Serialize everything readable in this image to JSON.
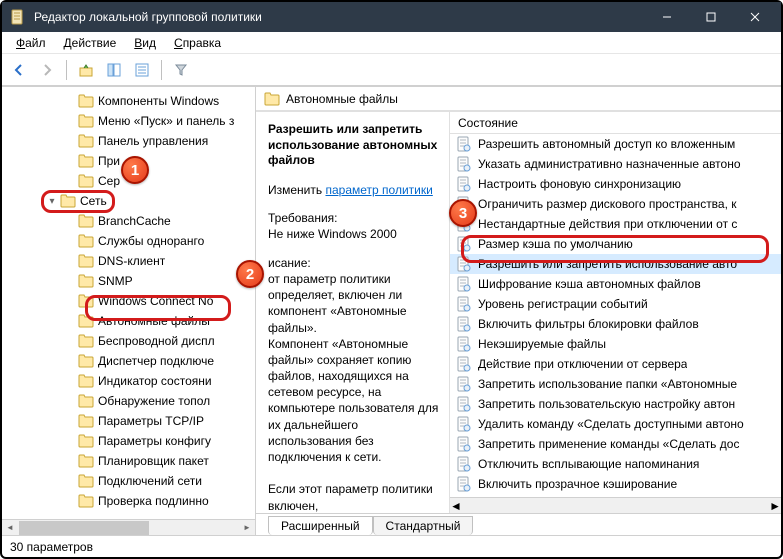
{
  "window": {
    "title": "Редактор локальной групповой политики"
  },
  "menubar": [
    "Файл",
    "Действие",
    "Вид",
    "Справка"
  ],
  "tree": [
    {
      "indent": 3,
      "exp": "",
      "label": "Компоненты Windows"
    },
    {
      "indent": 3,
      "exp": "",
      "label": "Меню «Пуск» и панель з"
    },
    {
      "indent": 3,
      "exp": "",
      "label": "Панель управления"
    },
    {
      "indent": 3,
      "exp": "",
      "label": "При"
    },
    {
      "indent": 3,
      "exp": "",
      "label": "Сер"
    },
    {
      "indent": 2,
      "exp": "▾",
      "label": "Сеть"
    },
    {
      "indent": 3,
      "exp": "",
      "label": "BranchCache"
    },
    {
      "indent": 3,
      "exp": "",
      "label": "Службы одноранго"
    },
    {
      "indent": 3,
      "exp": "",
      "label": "DNS-клиент"
    },
    {
      "indent": 3,
      "exp": "",
      "label": "SNMP"
    },
    {
      "indent": 3,
      "exp": "",
      "label": "Windows Connect No"
    },
    {
      "indent": 3,
      "exp": "",
      "label": "Автономные файлы"
    },
    {
      "indent": 3,
      "exp": "",
      "label": "Беспроводной диспл"
    },
    {
      "indent": 3,
      "exp": "",
      "label": "Диспетчер подключе"
    },
    {
      "indent": 3,
      "exp": "",
      "label": "Индикатор состояни"
    },
    {
      "indent": 3,
      "exp": "",
      "label": "Обнаружение топол"
    },
    {
      "indent": 3,
      "exp": "",
      "label": "Параметры TCP/IP"
    },
    {
      "indent": 3,
      "exp": "",
      "label": "Параметры конфигу"
    },
    {
      "indent": 3,
      "exp": "",
      "label": "Планировщик пакет"
    },
    {
      "indent": 3,
      "exp": "",
      "label": "Подключений сети"
    },
    {
      "indent": 3,
      "exp": "",
      "label": "Проверка подлинно"
    }
  ],
  "right": {
    "heading": "Автономные файлы",
    "desc": {
      "title": "Разрешить или запретить использование автономных файлов",
      "edit_label": "Изменить",
      "edit_link": "параметр политики",
      "req_label": "Требования:",
      "req_value": "Не ниже Windows 2000",
      "body_label": "исание:",
      "body": "от параметр политики определяет, включен ли компонент «Автономные файлы».\nКомпонент «Автономные файлы» сохраняет копию файлов, находящихся на сетевом ресурсе, на компьютере пользователя для их дальнейшего использования без подключения к сети.\n\nЕсли этот параметр политики включен,"
    },
    "list_header": "Состояние",
    "items": [
      "Разрешить автономный доступ ко вложенным",
      "Указать административно назначенные автоно",
      "Настроить фоновую синхронизацию",
      "Ограничить размер дискового пространства, к",
      "Нестандартные действия при отключении от с",
      "Размер кэша по умолчанию",
      "Разрешить или запретить использование авто",
      "Шифрование кэша автономных файлов",
      "Уровень регистрации событий",
      "Включить фильтры блокировки файлов",
      "Некэшируемые файлы",
      "Действие при отключении от сервера",
      "Запретить использование папки «Автономные",
      "Запретить пользовательскую настройку автон",
      "Удалить команду «Сделать доступными автоно",
      "Запретить применение команды «Сделать дос",
      "Отключить всплывающие напоминания",
      "Включить прозрачное кэширование"
    ],
    "selected_index": 6
  },
  "tabs": {
    "extended": "Расширенный",
    "standard": "Стандартный"
  },
  "statusbar": "30 параметров",
  "callouts": {
    "b1": "1",
    "b2": "2",
    "b3": "3"
  }
}
